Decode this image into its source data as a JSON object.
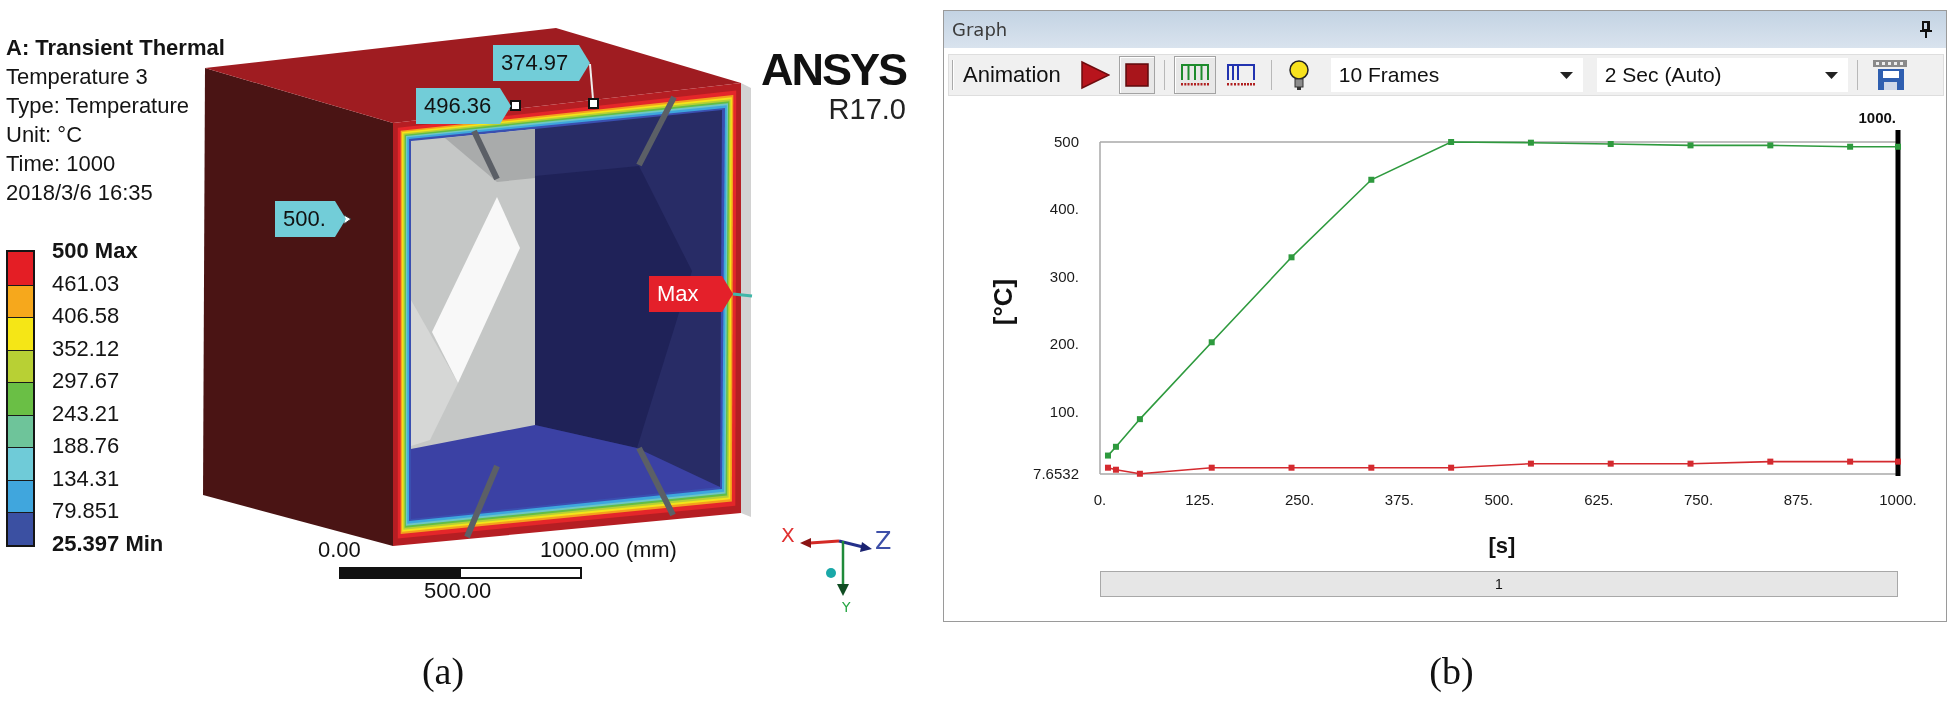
{
  "figure_a": {
    "header": {
      "title": "A: Transient Thermal",
      "lines": [
        "Temperature 3",
        "Type: Temperature",
        "Unit: °C",
        "Time: 1000",
        "2018/3/6 16:35"
      ]
    },
    "legend": {
      "labels": [
        {
          "text": "500 Max",
          "kind": "max"
        },
        {
          "text": "461.03",
          "kind": "level"
        },
        {
          "text": "406.58",
          "kind": "level"
        },
        {
          "text": "352.12",
          "kind": "level"
        },
        {
          "text": "297.67",
          "kind": "level"
        },
        {
          "text": "243.21",
          "kind": "level"
        },
        {
          "text": "188.76",
          "kind": "level"
        },
        {
          "text": "134.31",
          "kind": "level"
        },
        {
          "text": "79.851",
          "kind": "level"
        },
        {
          "text": "25.397 Min",
          "kind": "min"
        }
      ],
      "bands": [
        {
          "color": "#e41e25"
        },
        {
          "color": "#f6a81c"
        },
        {
          "color": "#f5e616"
        },
        {
          "color": "#b8d034"
        },
        {
          "color": "#6abf45"
        },
        {
          "color": "#6ec49a"
        },
        {
          "color": "#6fcbd8"
        },
        {
          "color": "#40a6dd"
        },
        {
          "color": "#3b50a2"
        }
      ]
    },
    "probes": [
      {
        "text": "500.",
        "kind": "value"
      },
      {
        "text": "496.36",
        "kind": "value"
      },
      {
        "text": "374.97",
        "kind": "value"
      },
      {
        "text": "Max",
        "kind": "max"
      }
    ],
    "scale_bar": {
      "start": "0.00",
      "end": "1000.00 (mm)",
      "middle": "500.00"
    },
    "logo": {
      "name": "ANSYS",
      "version": "R17.0"
    },
    "triad": {
      "x": "X",
      "y": "Y",
      "z": "Z"
    },
    "caption": "(a)"
  },
  "figure_b": {
    "panel": {
      "title": "Graph",
      "toolbar": {
        "groups": [
          {
            "label": "Animation",
            "buttons": [
              {
                "kind": "play",
                "on": false
              },
              {
                "kind": "stop",
                "on": true
              }
            ]
          },
          {
            "buttons": [
              {
                "kind": "frames-distributed",
                "on": true
              },
              {
                "kind": "frames-result-sets",
                "on": false
              }
            ]
          },
          {
            "buttons": [
              {
                "kind": "hint",
                "on": false
              }
            ],
            "dropdowns": [
              {
                "value": "10 Frames"
              },
              {
                "value": "2 Sec (Auto)"
              }
            ]
          },
          {
            "buttons": [
              {
                "kind": "export",
                "on": false
              }
            ]
          }
        ]
      },
      "chart_data": {
        "type": "line",
        "xlabel": "[s]",
        "ylabel": "[°C]",
        "x": [
          10,
          20,
          50,
          140,
          240,
          340,
          440,
          540,
          640,
          740,
          840,
          940,
          1000
        ],
        "series": [
          {
            "color": "#2e9a3e",
            "marker": "square",
            "values": [
              35,
              48,
              89,
              203,
              329,
              444,
              500,
              499,
              497,
              495,
              495,
              493,
              493
            ]
          },
          {
            "color": "#d42a2f",
            "marker": "square",
            "values": [
              17,
              14,
              8,
              17,
              17,
              17,
              17,
              23,
              23,
              23,
              26,
              26,
              26
            ]
          }
        ],
        "xlim": [
          0,
          1000
        ],
        "ylim": [
          7.6532,
          500
        ],
        "xticks": [
          {
            "value": 0,
            "label": "0."
          },
          {
            "value": 125,
            "label": "125."
          },
          {
            "value": 250,
            "label": "250."
          },
          {
            "value": 375,
            "label": "375."
          },
          {
            "value": 500,
            "label": "500."
          },
          {
            "value": 625,
            "label": "625."
          },
          {
            "value": 750,
            "label": "750."
          },
          {
            "value": 875,
            "label": "875."
          },
          {
            "value": 1000,
            "label": "1000."
          }
        ],
        "yticks": [
          {
            "value": 7.6532,
            "label": "7.6532"
          },
          {
            "value": 100,
            "label": "100."
          },
          {
            "value": 200,
            "label": "200."
          },
          {
            "value": 300,
            "label": "300."
          },
          {
            "value": 400,
            "label": "400."
          },
          {
            "value": 500,
            "label": "500"
          }
        ],
        "ref_lines": [
          {
            "axis": "x",
            "value": 1000,
            "label": "1000.",
            "color": "#000000"
          }
        ]
      },
      "step_bar": {
        "label": "1"
      }
    },
    "caption": "(b)"
  }
}
